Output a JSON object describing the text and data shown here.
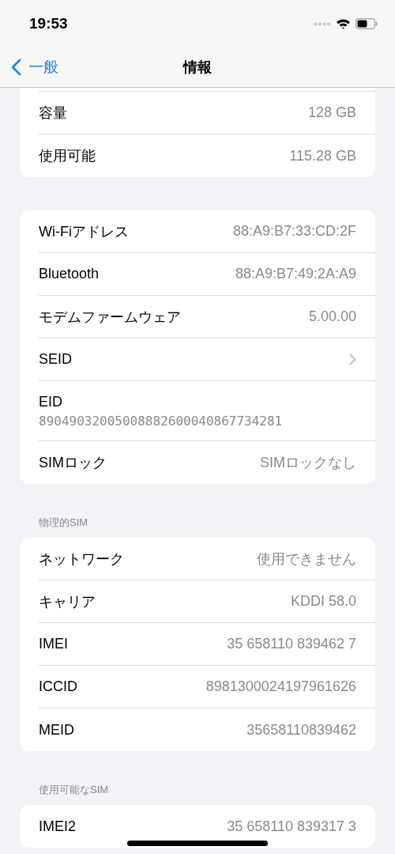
{
  "status_bar": {
    "time": "19:53"
  },
  "nav": {
    "back": "一般",
    "title": "情報"
  },
  "sections": [
    {
      "clipped_top": true,
      "rows": [
        {
          "kind": "value",
          "label": "容量",
          "value": "128 GB"
        },
        {
          "kind": "value",
          "label": "使用可能",
          "value": "115.28 GB"
        }
      ]
    },
    {
      "rows": [
        {
          "kind": "value",
          "label": "Wi-Fiアドレス",
          "value": "88:A9:B7:33:CD:2F"
        },
        {
          "kind": "value",
          "label": "Bluetooth",
          "value": "88:A9:B7:49:2A:A9"
        },
        {
          "kind": "value",
          "label": "モデムファームウェア",
          "value": "5.00.00"
        },
        {
          "kind": "chevron",
          "label": "SEID"
        },
        {
          "kind": "stacked",
          "label": "EID",
          "value": "89049032005008882600040867734281"
        },
        {
          "kind": "value",
          "label": "SIMロック",
          "value": "SIMロックなし"
        }
      ]
    },
    {
      "header": "物理的SIM",
      "rows": [
        {
          "kind": "value",
          "label": "ネットワーク",
          "value": "使用できません"
        },
        {
          "kind": "value",
          "label": "キャリア",
          "value": "KDDI 58.0"
        },
        {
          "kind": "value",
          "label": "IMEI",
          "value": "35 658110 839462 7"
        },
        {
          "kind": "value",
          "label": "ICCID",
          "value": "8981300024197961626"
        },
        {
          "kind": "value",
          "label": "MEID",
          "value": "35658110839462"
        }
      ]
    },
    {
      "header": "使用可能なSIM",
      "rows": [
        {
          "kind": "value",
          "label": "IMEI2",
          "value": "35 658110 839317 3"
        }
      ]
    }
  ]
}
